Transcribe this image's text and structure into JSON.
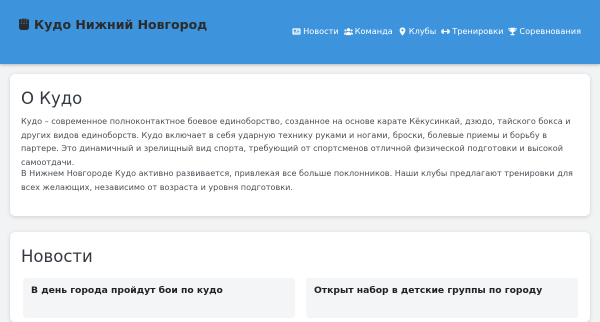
{
  "header": {
    "brand_icon": "fist-icon",
    "brand": "Кудо Нижний Новгород",
    "nav": [
      {
        "label": "Новости",
        "icon": "newspaper-icon"
      },
      {
        "label": "Команда",
        "icon": "users-icon"
      },
      {
        "label": "Клубы",
        "icon": "map-marker-icon"
      },
      {
        "label": "Тренировки",
        "icon": "dumbbell-icon"
      },
      {
        "label": "Соревнования",
        "icon": "trophy-icon"
      }
    ]
  },
  "about": {
    "title": "О Кудо",
    "paragraph_1": "Кудо – современное полноконтактное боевое единоборство, созданное на основе карате Кёкусинкай, дзюдо, тайского бокса и других видов единоборств. Кудо включает в себя ударную технику руками и ногами, броски, болевые приемы и борьбу в партере. Это динамичный и зрелищный вид спорта, требующий от спортсменов отличной физической подготовки и высокой самоотдачи.",
    "paragraph_2": "В Нижнем Новгороде Кудо активно развивается, привлекая все больше поклонников. Наши клубы предлагают тренировки для всех желающих, независимо от возраста и уровня подготовки."
  },
  "news": {
    "title": "Новости",
    "items": [
      {
        "title": "В день города пройдут бои по кудо"
      },
      {
        "title": "Открыт набор в детские группы по городу"
      }
    ]
  },
  "colors": {
    "header_bg": "#3d94dd",
    "page_bg": "#f2f3f4",
    "card_bg": "#ffffff"
  }
}
